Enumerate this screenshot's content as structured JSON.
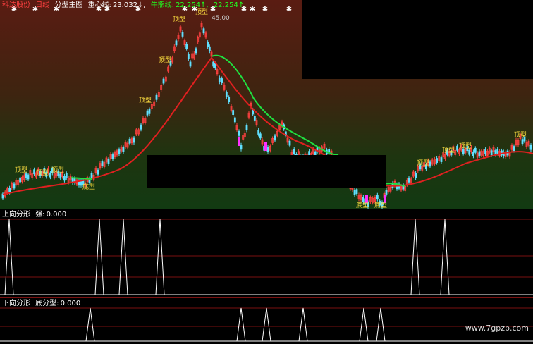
{
  "main": {
    "app_title": "科达股份",
    "period": "日线",
    "formula_name": "分型主图",
    "ind1_label": "重心线:",
    "ind1_value": "23.032↓,",
    "ind2_label": "牛熊线:",
    "ind2_value": "22.254↑,",
    "ind3_value": "22.254↑,",
    "max_price": "45.00",
    "top_label": "顶型",
    "bottom_label": "底型"
  },
  "sub1": {
    "title": "上向分形",
    "label": "强:",
    "value": "0.000"
  },
  "sub2": {
    "title": "下向分形",
    "label": "底分型:",
    "value": "0.000"
  },
  "watermark": "www.7gpzb.com",
  "colors": {
    "bg": "#000000",
    "grid_red": "#7a1010",
    "up_candle": "#ff4040",
    "down_candle": "#60e0ff",
    "ma_red": "#e02020",
    "ma_green": "#20e040",
    "top_label": "#ffe040",
    "magenta": "#ff30ff",
    "header_white": "#ffffff",
    "header_green": "#20ff20",
    "header_period": "#ff4040"
  }
}
